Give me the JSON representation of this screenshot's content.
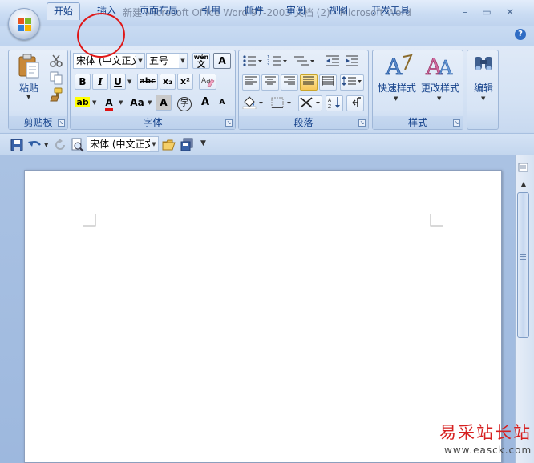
{
  "window": {
    "title": "新建 Microsoft Office Word 97-2003 文档 (2) - Microsoft Word",
    "min_glyph": "–",
    "max_glyph": "▭",
    "close_glyph": "✕"
  },
  "tabs": [
    {
      "label": "开始",
      "active": true
    },
    {
      "label": "插入",
      "active": false
    },
    {
      "label": "页面布局",
      "active": false
    },
    {
      "label": "引用",
      "active": false
    },
    {
      "label": "邮件",
      "active": false
    },
    {
      "label": "审阅",
      "active": false
    },
    {
      "label": "视图",
      "active": false
    },
    {
      "label": "开发工具",
      "active": false
    }
  ],
  "help_glyph": "?",
  "groups": {
    "clipboard": {
      "label": "剪贴板",
      "paste_label": "粘贴"
    },
    "font": {
      "label": "字体",
      "font_name": "宋体 (中文正文",
      "font_size": "五号",
      "bold": "B",
      "italic": "I",
      "underline": "U",
      "strike": "abc",
      "subscript": "x₂",
      "superscript": "x²",
      "grow": "A",
      "shrink": "A",
      "char_shading": "A",
      "phonetic": "wén",
      "border_char": "A",
      "change_case": "Aa",
      "enclose": "字",
      "highlight": "ab",
      "font_color": "A"
    },
    "paragraph": {
      "label": "段落"
    },
    "styles": {
      "label": "样式",
      "quick_styles": "快速样式",
      "change_styles": "更改样式"
    },
    "editing": {
      "label": "编辑"
    }
  },
  "qat": {
    "font_name": "宋体 (中文正文"
  },
  "colors": {
    "accent": "#15428b",
    "annotation": "#e01616",
    "watermark": "#d62020"
  },
  "watermark": {
    "main": "易采站长站",
    "sub": "www.easck.com"
  }
}
